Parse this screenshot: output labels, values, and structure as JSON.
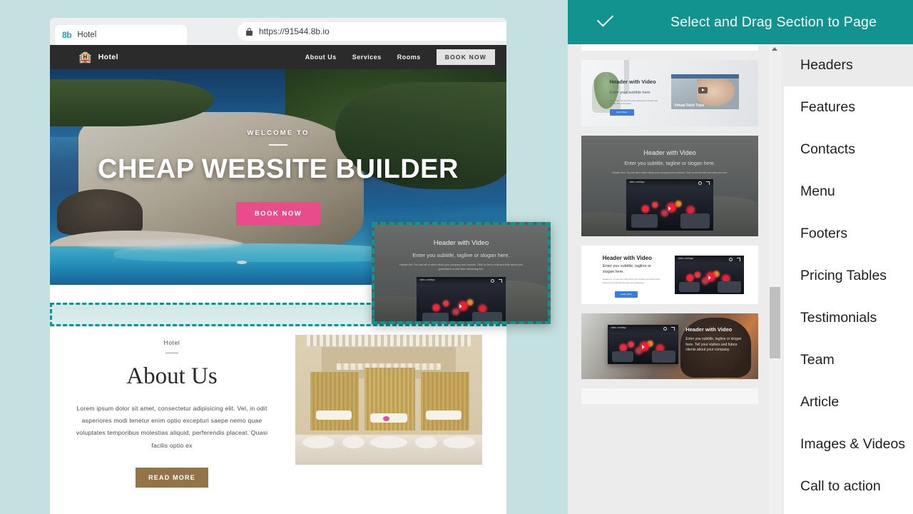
{
  "browser": {
    "tab": {
      "favicon_label": "8b",
      "title": "Hotel"
    },
    "address_bar": {
      "url": "https://91544.8b.io",
      "lock_icon": "lock-icon"
    }
  },
  "site": {
    "nav": {
      "brand_icon": "hotel-building-icon",
      "brand_name": "Hotel",
      "links": [
        "About Us",
        "Services",
        "Rooms"
      ],
      "cta_label": "BOOK NOW"
    },
    "hero": {
      "kicker": "WELCOME TO",
      "title": "CHEAP WEBSITE BUILDER",
      "cta_label": "BOOK NOW"
    },
    "about": {
      "kicker": "Hotel",
      "title": "About Us",
      "body": "Lorem ipsum dolor sit amet, consectetur adipisicing elit. Vel, in odit asperiores modi tenetur enim optio excepturi saepe nemo quae voluptates temporibus molestias aliquid, perferendis placeat. Quasi facilis optio ex",
      "cta_label": "READ MORE"
    }
  },
  "drag_preview": {
    "title": "Header with Video",
    "subtitle": "Enter you subtitle, tagline or slogan here.",
    "paragraph": "Header text. You can tell a visitor about your company and services. Click on text to edit and write about your guarantees or add other interesting text.",
    "video_label": "video overlays"
  },
  "panel": {
    "header": {
      "icon": "check-icon",
      "title": "Select and  Drag Section to  Page"
    },
    "thumbnails": [
      {
        "name": "flowers-header",
        "title": ""
      },
      {
        "name": "header-with-video-light",
        "title": "Header with Video",
        "subtitle": "Enter your subtitle here",
        "paragraph": "Header text. You can tell a visitor about your company and services here in this block.",
        "button": "Learn More",
        "video_caption": "Virtual Field Trips"
      },
      {
        "name": "header-with-video-dark",
        "title": "Header with Video",
        "subtitle": "Enter you subtitle, tagline or slogan here.",
        "paragraph": "Header text. You can tell a visitor about your company and services. Click on text to edit and write your text.",
        "video_label": "video overlays"
      },
      {
        "name": "header-with-video-white",
        "title": "Header with Video",
        "subtitle": "Enter you subtitle, tagline or slogan here.",
        "paragraph": "Header text. You can tell a visitor about your company and services here. Click on text to edit and write about your guarantees.",
        "button": "Learn More",
        "video_label": "video overlays"
      },
      {
        "name": "header-with-video-split",
        "title": "Header with Video",
        "paragraph": "Enter you subtitle, tagline or slogan here. Tell your visitors and future clients about your company.",
        "video_label": "video overlays"
      },
      {
        "name": "partial-thumbnail",
        "title": ""
      }
    ],
    "categories": [
      "Headers",
      "Features",
      "Contacts",
      "Menu",
      "Footers",
      "Pricing Tables",
      "Testimonials",
      "Team",
      "Article",
      "Images & Videos",
      "Call to action"
    ],
    "active_category": "Headers",
    "scrollbar": {
      "up_arrow_icon": "chevron-up-icon"
    }
  },
  "colors": {
    "accent_teal": "#12938f",
    "page_bg": "#c4e0e0",
    "hero_cta_pink": "#ea4c89",
    "about_cta_brown": "#937449"
  }
}
